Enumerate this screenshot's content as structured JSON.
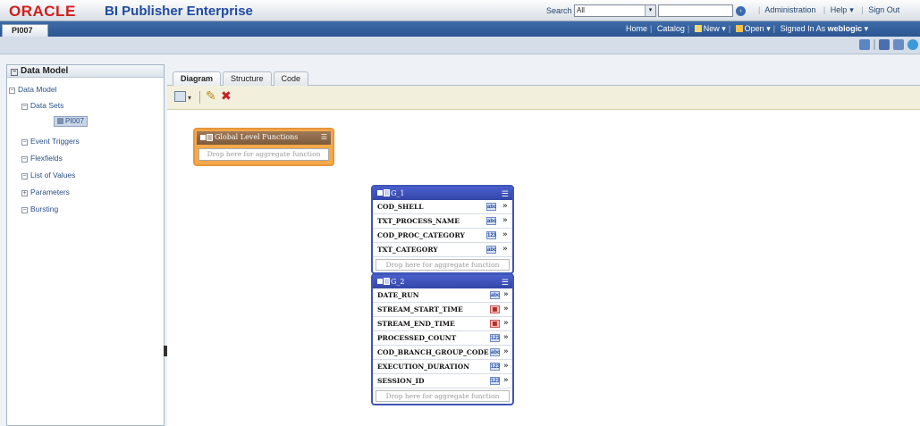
{
  "header": {
    "logo": "ORACLE",
    "product": "BI Publisher Enterprise",
    "search_label": "Search",
    "search_scope": "All",
    "links": [
      "Administration",
      "Help",
      "Sign Out"
    ]
  },
  "nav": {
    "doc_tab": "PI007",
    "home": "Home",
    "catalog": "Catalog",
    "new": "New",
    "open": "Open",
    "signed_in_as": "Signed In As",
    "user": "weblogic"
  },
  "left_panel": {
    "title": "Data Model",
    "root": "Data Model",
    "items": [
      "Data Sets",
      "Event Triggers",
      "Flexfields",
      "List of Values",
      "Parameters",
      "Bursting"
    ],
    "data_set_node": "PI007"
  },
  "tabs": [
    "Diagram",
    "Structure",
    "Code"
  ],
  "global_functions": {
    "title": "Global Level Functions",
    "drop_text": "Drop here for aggregate function"
  },
  "groups": [
    {
      "name": "G_1",
      "columns": [
        {
          "name": "COD_SHELL",
          "type": "abc"
        },
        {
          "name": "TXT_PROCESS_NAME",
          "type": "abc"
        },
        {
          "name": "COD_PROC_CATEGORY",
          "type": "num"
        },
        {
          "name": "TXT_CATEGORY",
          "type": "abc"
        }
      ],
      "drop_text": "Drop here for aggregate function"
    },
    {
      "name": "G_2",
      "columns": [
        {
          "name": "DATE_RUN",
          "type": "abc"
        },
        {
          "name": "STREAM_START_TIME",
          "type": "date"
        },
        {
          "name": "STREAM_END_TIME",
          "type": "date"
        },
        {
          "name": "PROCESSED_COUNT",
          "type": "num"
        },
        {
          "name": "COD_BRANCH_GROUP_CODE",
          "type": "abc"
        },
        {
          "name": "EXECUTION_DURATION",
          "type": "num"
        },
        {
          "name": "SESSION_ID",
          "type": "num"
        }
      ],
      "drop_text": "Drop here for aggregate function"
    }
  ],
  "type_labels": {
    "abc": "abc",
    "num": "123",
    "date": "▦"
  },
  "colors": {
    "brand_red": "#d11d1d",
    "brand_blue": "#1e4aa0",
    "group_blue": "#3f56b8",
    "global_orange": "#f6a94b"
  }
}
